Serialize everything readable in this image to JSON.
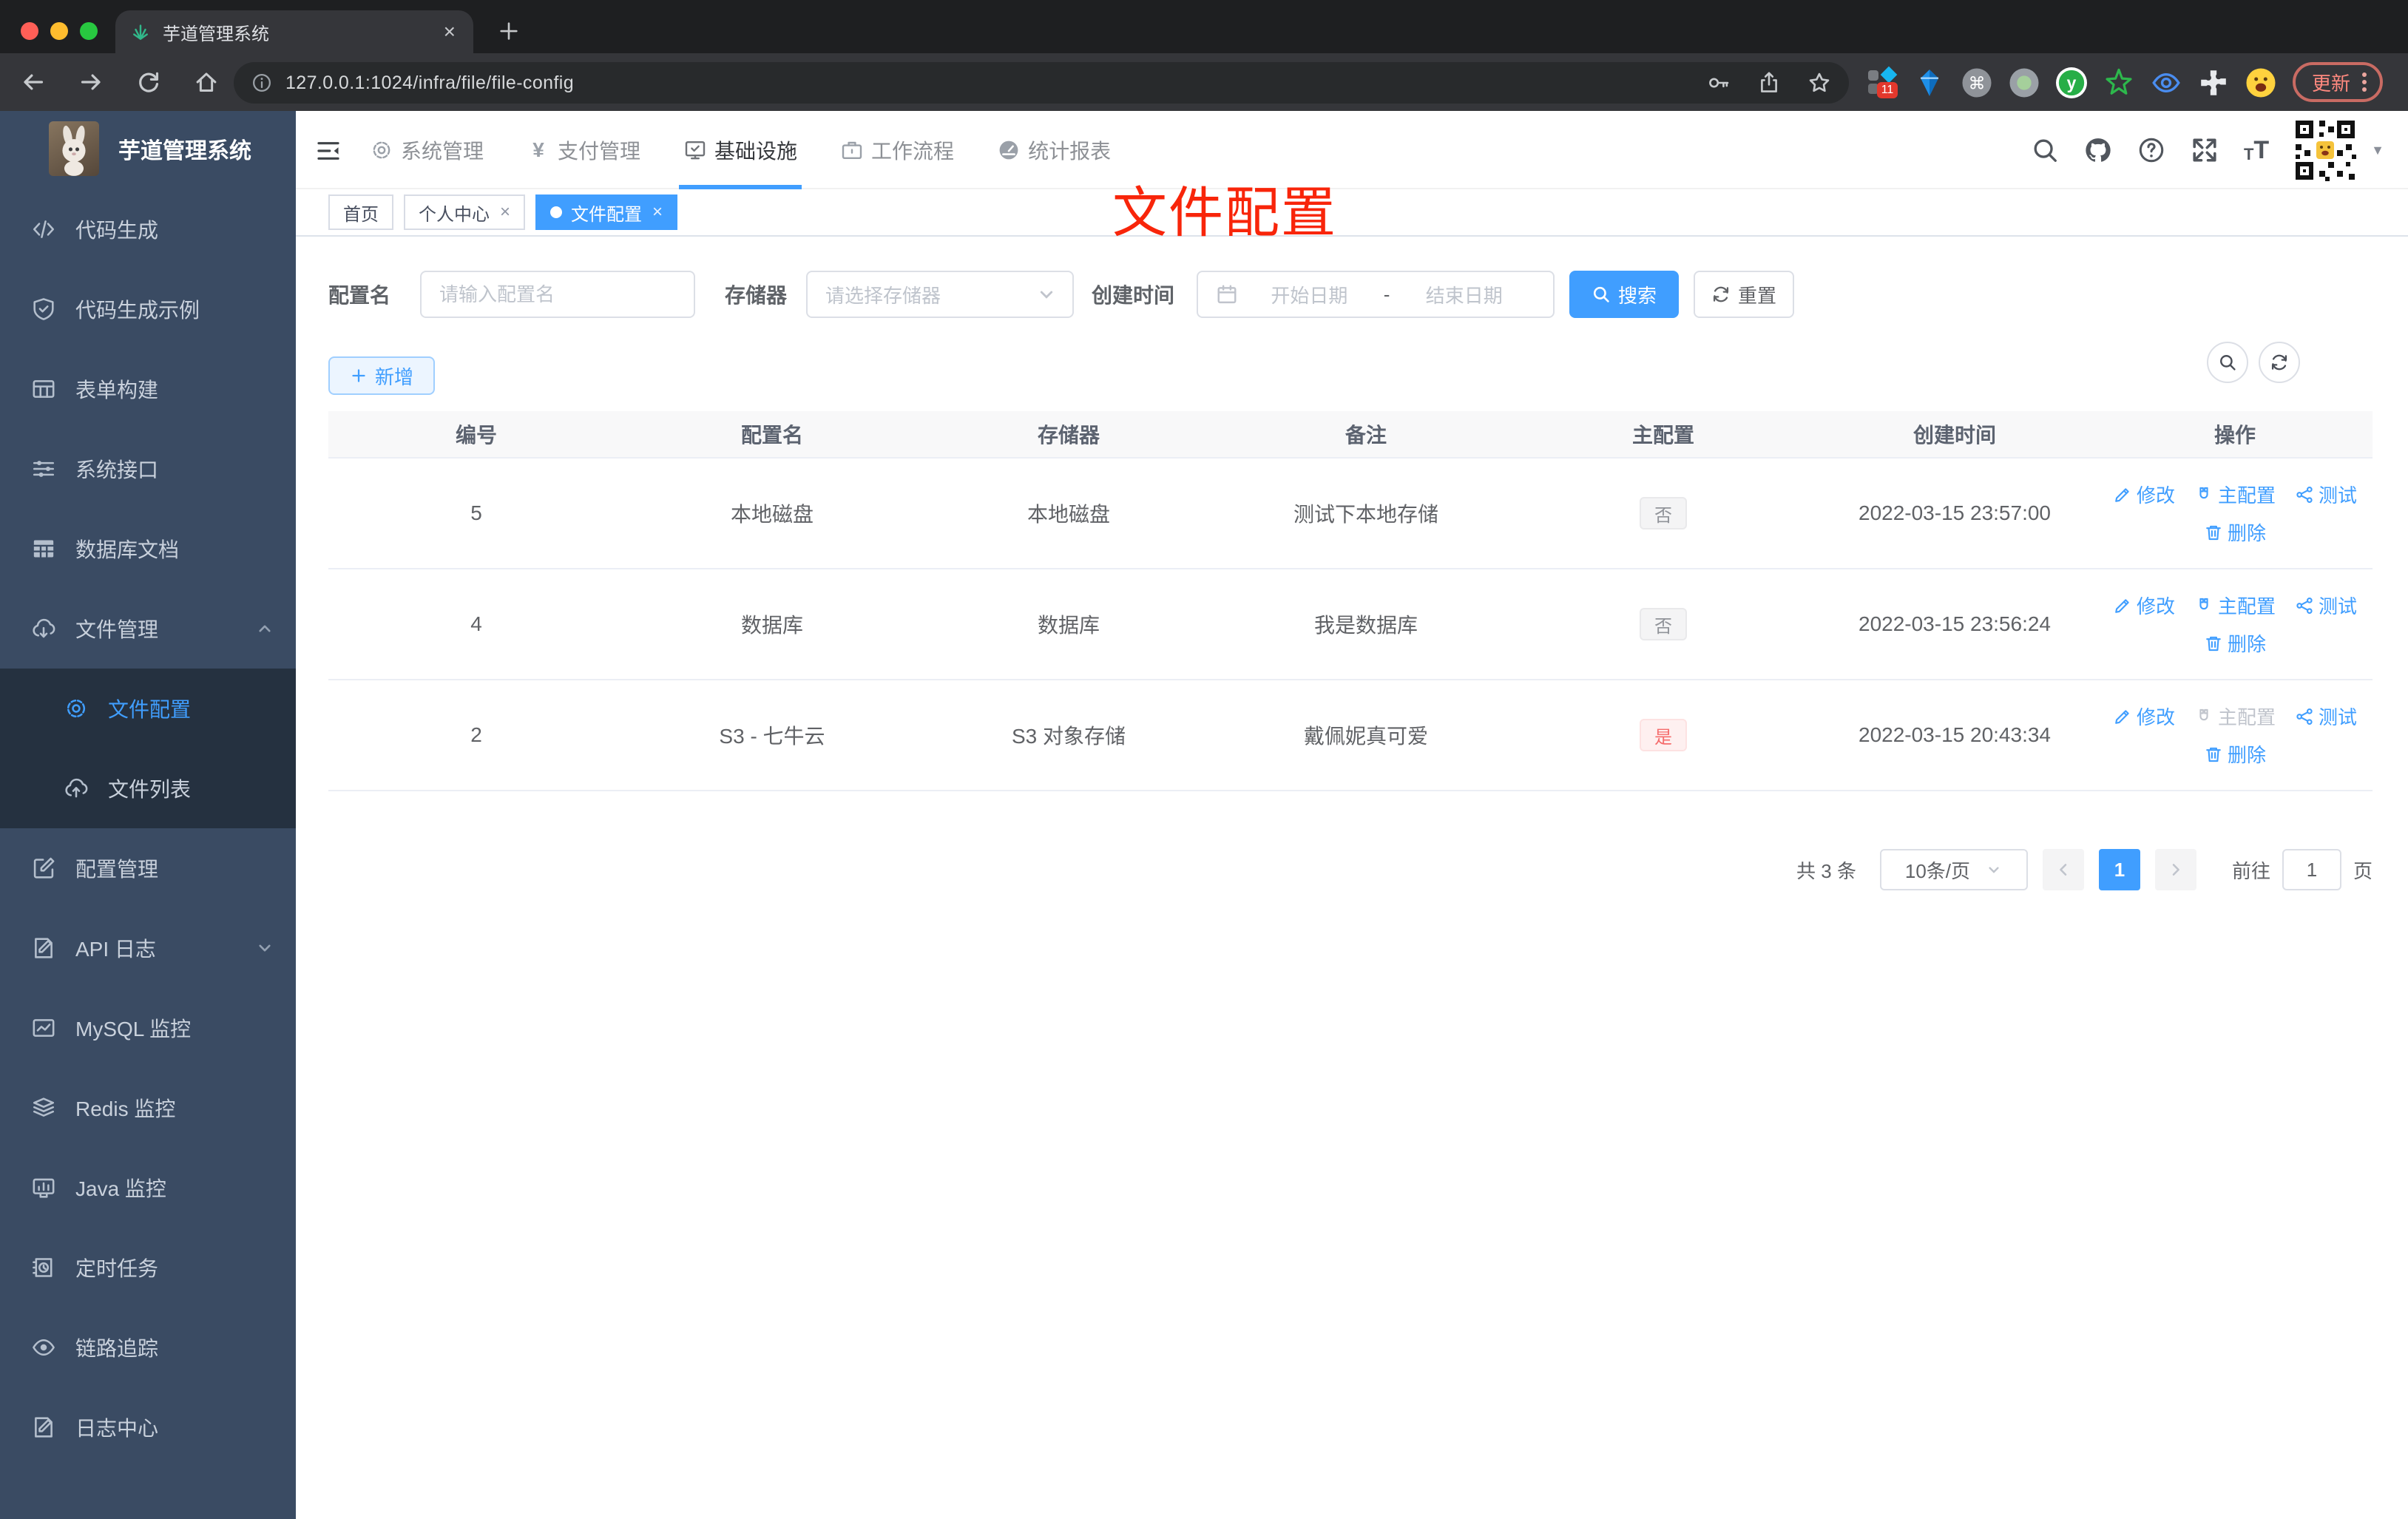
{
  "browser": {
    "tab_title": "芋道管理系统",
    "url": "127.0.0.1:1024/infra/file/file-config",
    "update_label": "更新",
    "ext_badge": "11"
  },
  "sidebar": {
    "logo_title": "芋道管理系统",
    "items": [
      {
        "label": "代码生成",
        "icon": "code"
      },
      {
        "label": "代码生成示例",
        "icon": "shield-check"
      },
      {
        "label": "表单构建",
        "icon": "form-table"
      },
      {
        "label": "系统接口",
        "icon": "sliders"
      },
      {
        "label": "数据库文档",
        "icon": "db-table"
      },
      {
        "label": "文件管理",
        "icon": "cloud-download",
        "caret": "up",
        "children": [
          {
            "label": "文件配置",
            "icon": "gear",
            "active": true
          },
          {
            "label": "文件列表",
            "icon": "cloud-upload"
          }
        ]
      },
      {
        "label": "配置管理",
        "icon": "edit-square"
      },
      {
        "label": "API 日志",
        "icon": "doc-edit",
        "caret": "down"
      },
      {
        "label": "MySQL 监控",
        "icon": "chart-box"
      },
      {
        "label": "Redis 监控",
        "icon": "layers"
      },
      {
        "label": "Java 监控",
        "icon": "monitor-bars"
      },
      {
        "label": "定时任务",
        "icon": "timer-book"
      },
      {
        "label": "链路追踪",
        "icon": "eye"
      },
      {
        "label": "日志中心",
        "icon": "doc-edit"
      }
    ]
  },
  "header": {
    "nav": [
      {
        "label": "系统管理",
        "icon": "gear"
      },
      {
        "label": "支付管理",
        "icon": "yen"
      },
      {
        "label": "基础设施",
        "icon": "infra",
        "active": true
      },
      {
        "label": "工作流程",
        "icon": "briefcase"
      },
      {
        "label": "统计报表",
        "icon": "gauge"
      }
    ]
  },
  "tags": [
    {
      "label": "首页",
      "closable": false,
      "active": false
    },
    {
      "label": "个人中心",
      "closable": true,
      "active": false
    },
    {
      "label": "文件配置",
      "closable": true,
      "active": true
    }
  ],
  "annotation": {
    "text": "文件配置"
  },
  "filters": {
    "config_name_label": "配置名",
    "config_name_placeholder": "请输入配置名",
    "storage_label": "存储器",
    "storage_placeholder": "请选择存储器",
    "create_time_label": "创建时间",
    "start_placeholder": "开始日期",
    "range_separator": "-",
    "end_placeholder": "结束日期",
    "search_label": "搜索",
    "reset_label": "重置"
  },
  "toolbar": {
    "add_label": "新增"
  },
  "table": {
    "columns": [
      "编号",
      "配置名",
      "存储器",
      "备注",
      "主配置",
      "创建时间",
      "操作"
    ],
    "actions": {
      "edit": "修改",
      "master": "主配置",
      "test": "测试",
      "delete": "删除"
    },
    "rows": [
      {
        "id": "5",
        "name": "本地磁盘",
        "storage": "本地磁盘",
        "remark": "测试下本地存储",
        "master": "否",
        "master_type": "info",
        "time": "2022-03-15 23:57:00",
        "master_disabled": false
      },
      {
        "id": "4",
        "name": "数据库",
        "storage": "数据库",
        "remark": "我是数据库",
        "master": "否",
        "master_type": "info",
        "time": "2022-03-15 23:56:24",
        "master_disabled": false
      },
      {
        "id": "2",
        "name": "S3 - 七牛云",
        "storage": "S3 对象存储",
        "remark": "戴佩妮真可爱",
        "master": "是",
        "master_type": "danger",
        "time": "2022-03-15 20:43:34",
        "master_disabled": true
      }
    ]
  },
  "pagination": {
    "total_label": "共 3 条",
    "page_size_label": "10条/页",
    "current_page": "1",
    "goto_label": "前往",
    "goto_value": "1",
    "page_unit": "页"
  },
  "colors": {
    "accent": "#409eff",
    "danger": "#f56c6c",
    "annotation": "#f8250a"
  }
}
